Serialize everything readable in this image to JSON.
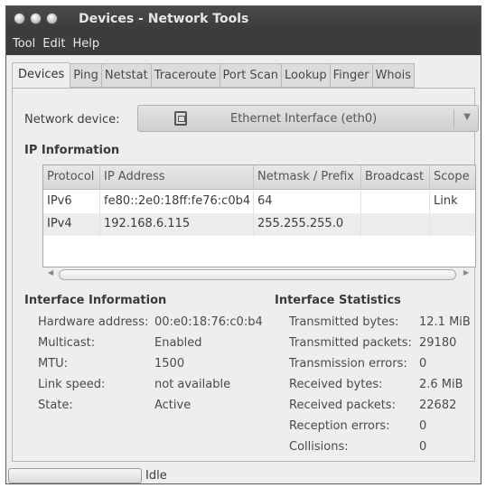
{
  "window": {
    "title": "Devices - Network Tools"
  },
  "menubar": {
    "items": [
      "Tool",
      "Edit",
      "Help"
    ]
  },
  "tabs": [
    "Devices",
    "Ping",
    "Netstat",
    "Traceroute",
    "Port Scan",
    "Lookup",
    "Finger",
    "Whois"
  ],
  "active_tab": "Devices",
  "device": {
    "label": "Network device:",
    "selected": "Ethernet Interface (eth0)"
  },
  "ip_info": {
    "title": "IP Information",
    "columns": [
      "Protocol",
      "IP Address",
      "Netmask / Prefix",
      "Broadcast",
      "Scope"
    ],
    "rows": [
      [
        "IPv6",
        "fe80::2e0:18ff:fe76:c0b4",
        "64",
        "",
        "Link"
      ],
      [
        "IPv4",
        "192.168.6.115",
        "255.255.255.0",
        "",
        ""
      ]
    ]
  },
  "interface_info": {
    "title": "Interface Information",
    "items": [
      {
        "key": "Hardware address:",
        "value": "00:e0:18:76:c0:b4"
      },
      {
        "key": "Multicast:",
        "value": "Enabled"
      },
      {
        "key": "MTU:",
        "value": "1500"
      },
      {
        "key": "Link speed:",
        "value": "not available"
      },
      {
        "key": "State:",
        "value": "Active"
      }
    ]
  },
  "interface_stats": {
    "title": "Interface Statistics",
    "items": [
      {
        "key": "Transmitted bytes:",
        "value": "12.1 MiB"
      },
      {
        "key": "Transmitted packets:",
        "value": "29180"
      },
      {
        "key": "Transmission errors:",
        "value": "0"
      },
      {
        "key": "Received bytes:",
        "value": "2.6 MiB"
      },
      {
        "key": "Received packets:",
        "value": "22682"
      },
      {
        "key": "Reception errors:",
        "value": "0"
      },
      {
        "key": "Collisions:",
        "value": "0"
      }
    ]
  },
  "status": {
    "text": "Idle"
  }
}
